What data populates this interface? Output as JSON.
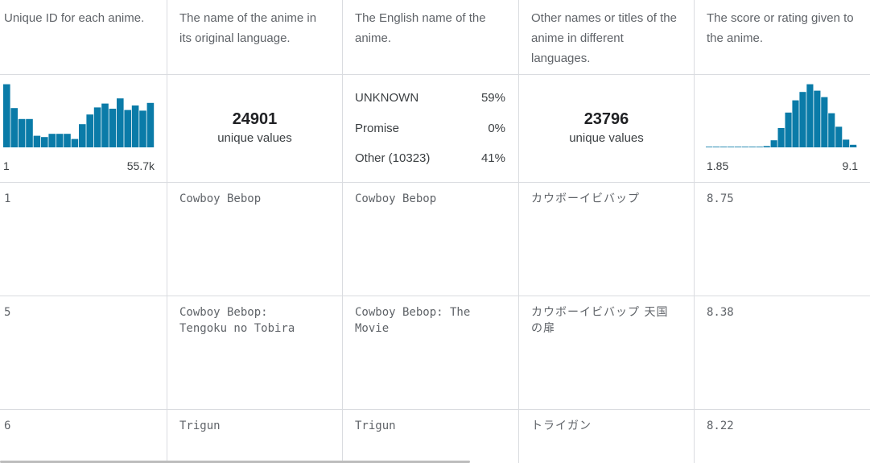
{
  "headers": {
    "col1": "Unique ID for each anime.",
    "col2": "The name of the anime in its original language.",
    "col3": "The English name of the anime.",
    "col4": "Other names or titles of the anime in different languages.",
    "col5": "The score or rating given to the anime."
  },
  "summary": {
    "id_hist": {
      "values": [
        0.98,
        0.61,
        0.44,
        0.44,
        0.18,
        0.16,
        0.21,
        0.21,
        0.21,
        0.13,
        0.36,
        0.51,
        0.62,
        0.68,
        0.6,
        0.76,
        0.58,
        0.65,
        0.57,
        0.69
      ],
      "min_label": "1",
      "max_label": "55.7k",
      "color": "#0a7ba8"
    },
    "name": {
      "count": "24901",
      "label": "unique values"
    },
    "english": {
      "rows": [
        {
          "label": "UNKNOWN",
          "pct": "59%"
        },
        {
          "label": "Promise",
          "pct": "0%"
        },
        {
          "label": "Other (10323)",
          "pct": "41%"
        }
      ]
    },
    "other": {
      "count": "23796",
      "label": "unique values"
    },
    "score_hist": {
      "values": [
        0.01,
        0.01,
        0.01,
        0.01,
        0.01,
        0.01,
        0.01,
        0.01,
        0.02,
        0.11,
        0.3,
        0.54,
        0.73,
        0.86,
        0.98,
        0.88,
        0.78,
        0.53,
        0.32,
        0.12,
        0.04
      ],
      "min_label": "1.85",
      "max_label": "9.1",
      "color": "#0a7ba8"
    }
  },
  "rows": [
    {
      "id": "1",
      "name": "Cowboy Bebop",
      "english": "Cowboy Bebop",
      "other": "カウボーイビバップ",
      "score": "8.75"
    },
    {
      "id": "5",
      "name": "Cowboy Bebop:\nTengoku no Tobira",
      "english": "Cowboy Bebop: The\nMovie",
      "other": "カウボーイビバップ 天国\nの扉",
      "score": "8.38"
    },
    {
      "id": "6",
      "name": "Trigun",
      "english": "Trigun",
      "other": "トライガン",
      "score": "8.22"
    }
  ]
}
